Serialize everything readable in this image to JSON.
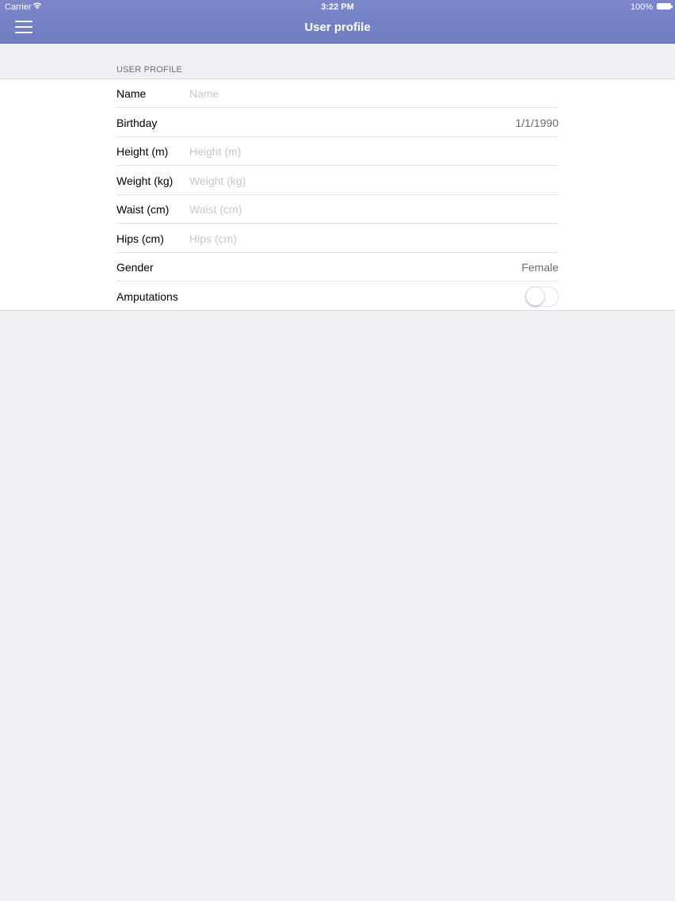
{
  "status_bar": {
    "carrier": "Carrier",
    "time": "3:22 PM",
    "battery": "100%"
  },
  "nav": {
    "title": "User profile",
    "menu_icon": "hamburger-menu-icon"
  },
  "section": {
    "header": "USER PROFILE"
  },
  "rows": {
    "name": {
      "label": "Name",
      "placeholder": "Name",
      "value": ""
    },
    "birthday": {
      "label": "Birthday",
      "value": "1/1/1990"
    },
    "height": {
      "label": "Height (m)",
      "placeholder": "Height (m)",
      "value": ""
    },
    "weight": {
      "label": "Weight (kg)",
      "placeholder": "Weight (kg)",
      "value": ""
    },
    "waist": {
      "label": "Waist (cm)",
      "placeholder": "Waist (cm)",
      "value": ""
    },
    "hips": {
      "label": "Hips (cm)",
      "placeholder": "Hips (cm)",
      "value": ""
    },
    "gender": {
      "label": "Gender",
      "value": "Female"
    },
    "amputations": {
      "label": "Amputations",
      "enabled": false
    }
  },
  "colors": {
    "nav_bar": "#7380c5",
    "background": "#efeff4",
    "placeholder": "#c7c7cd"
  }
}
